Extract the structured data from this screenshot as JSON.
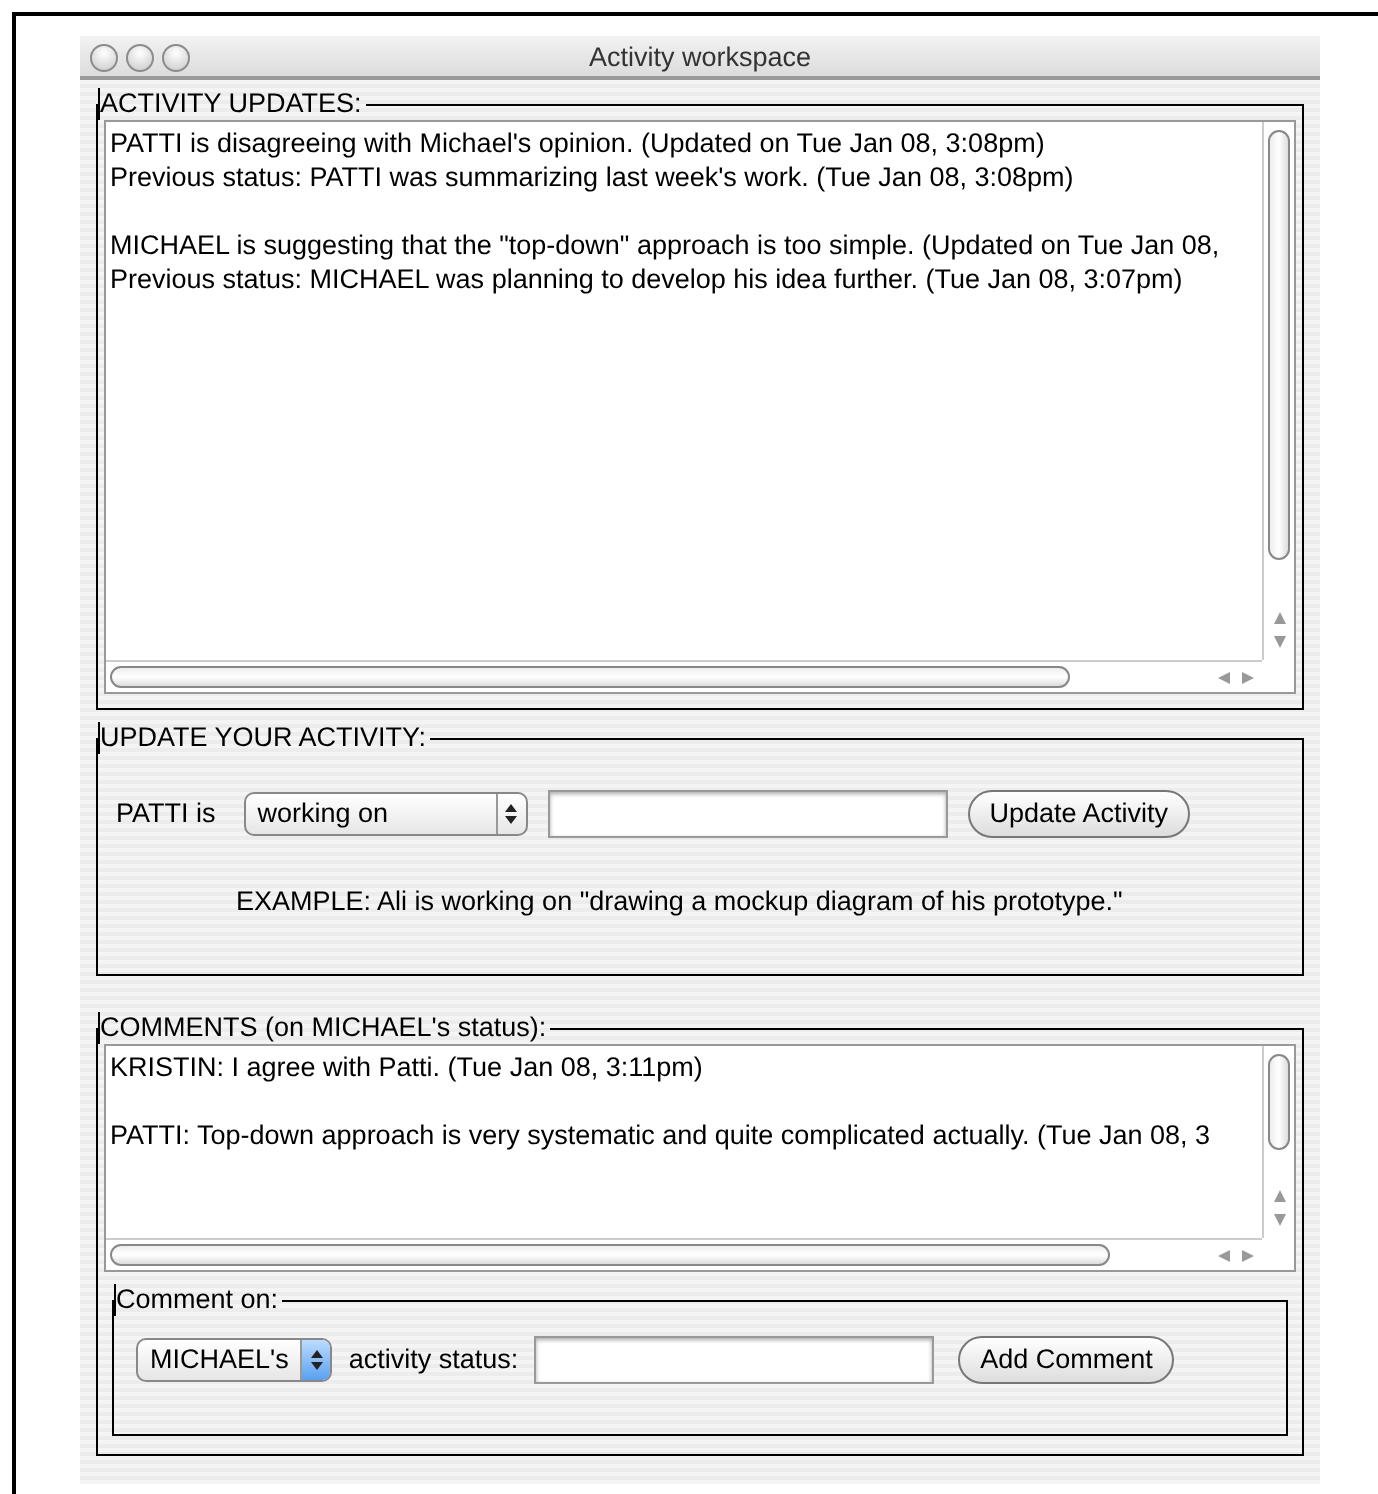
{
  "window": {
    "title": "Activity workspace"
  },
  "activity_updates": {
    "legend": "ACTIVITY UPDATES:",
    "entries": [
      {
        "lines": [
          "PATTI is disagreeing with Michael's opinion. (Updated on Tue Jan 08, 3:08pm)",
          "Previous status: PATTI was summarizing last week's work. (Tue Jan 08, 3:08pm)"
        ]
      },
      {
        "lines": [
          "MICHAEL is suggesting that the \"top-down\" approach is too simple. (Updated on Tue Jan 08,",
          "Previous status: MICHAEL was planning to develop his idea further. (Tue Jan 08, 3:07pm)"
        ]
      }
    ]
  },
  "update_activity": {
    "legend": "UPDATE YOUR ACTIVITY:",
    "name_label": "PATTI is",
    "verb_select": {
      "value": "working on",
      "focused": false
    },
    "update_button": "Update Activity",
    "example": "EXAMPLE: Ali is working on \"drawing a mockup diagram of his prototype.\""
  },
  "comments": {
    "legend": "COMMENTS (on MICHAEL's status):",
    "entries": [
      {
        "lines": [
          "KRISTIN: I agree with Patti. (Tue Jan 08, 3:11pm)"
        ]
      },
      {
        "lines": [
          "PATTI: Top-down approach is very systematic and quite complicated actually. (Tue Jan 08, 3"
        ]
      }
    ],
    "comment_on": {
      "legend": "Comment on:",
      "target_select": {
        "value": "MICHAEL's",
        "focused": true
      },
      "label": "activity status:",
      "add_button": "Add Comment"
    }
  }
}
